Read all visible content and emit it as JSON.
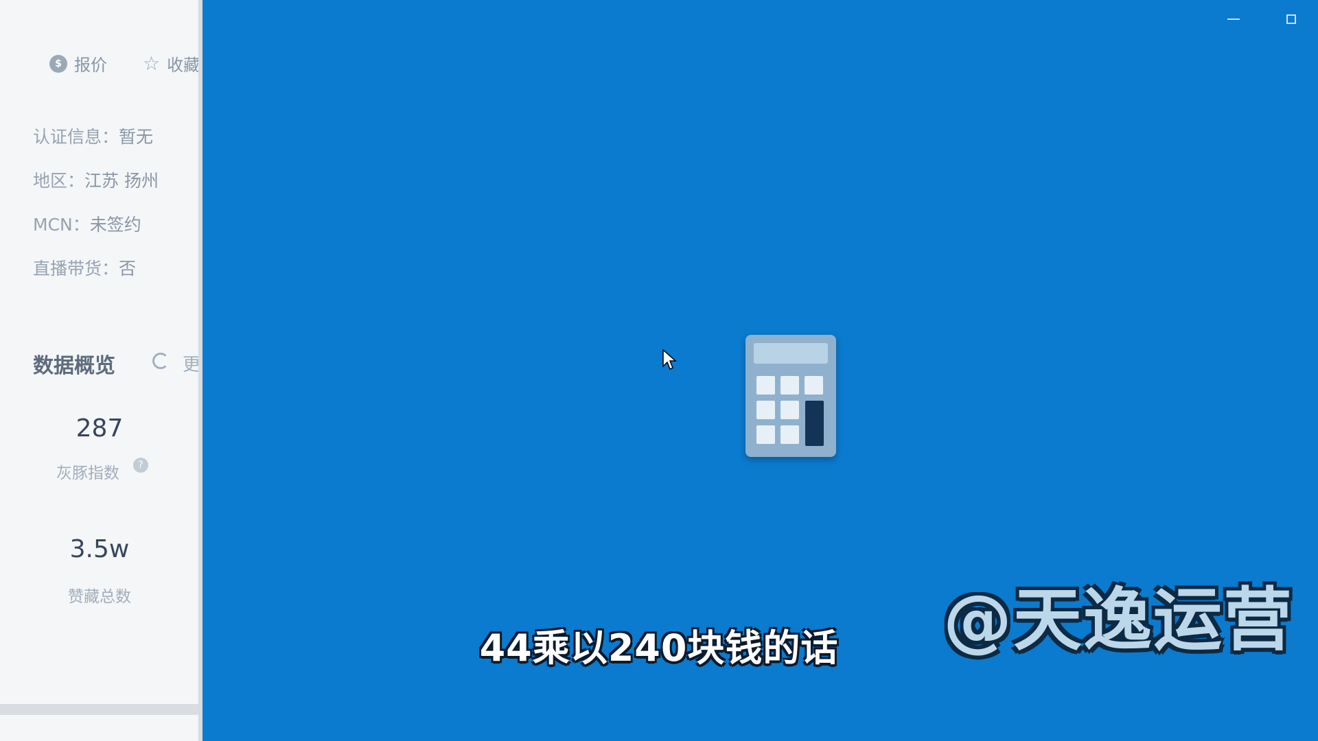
{
  "left_panel": {
    "actions": {
      "quote_label": "报价",
      "favorite_label": "收藏"
    },
    "info": [
      {
        "label": "认证信息：",
        "value": "暂无"
      },
      {
        "label": "地区：",
        "value": "江苏 扬州"
      },
      {
        "label": "MCN：",
        "value": "未签约"
      },
      {
        "label": "直播带货：",
        "value": "否"
      }
    ],
    "data_overview": {
      "title": "数据概览",
      "refresh_label": "更"
    },
    "stats": [
      {
        "value": "287",
        "label": "灰豚指数"
      },
      {
        "value": "3.5w",
        "label": "赞藏总数"
      }
    ]
  },
  "subtitle": "44乘以240块钱的话",
  "watermark": "@天逸运营",
  "icons": [
    "price-icon",
    "star-icon",
    "refresh-icon",
    "help-icon",
    "minimize-icon",
    "maximize-icon",
    "cursor-icon",
    "calculator-icon"
  ],
  "colors": {
    "desktop_background": "#0a7bce",
    "panel_background": "#f4f6f8"
  }
}
